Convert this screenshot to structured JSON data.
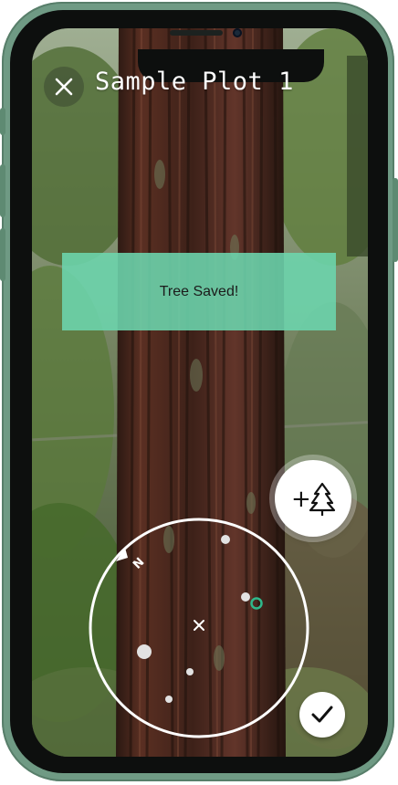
{
  "header": {
    "title": "Sample Plot 1",
    "close_icon": "close-icon"
  },
  "toast": {
    "message": "Tree Saved!",
    "color": "#6cd6ae"
  },
  "add_tree": {
    "label": "+",
    "icon": "tree-icon"
  },
  "compass": {
    "north_label": "N",
    "center_icon": "x-marker-icon",
    "highlight_color": "#2fb88b"
  },
  "confirm": {
    "icon": "checkmark-icon"
  },
  "colors": {
    "frame": "#6f9a84",
    "bezel": "#0d0f0e",
    "accent": "#6cd6ae"
  }
}
